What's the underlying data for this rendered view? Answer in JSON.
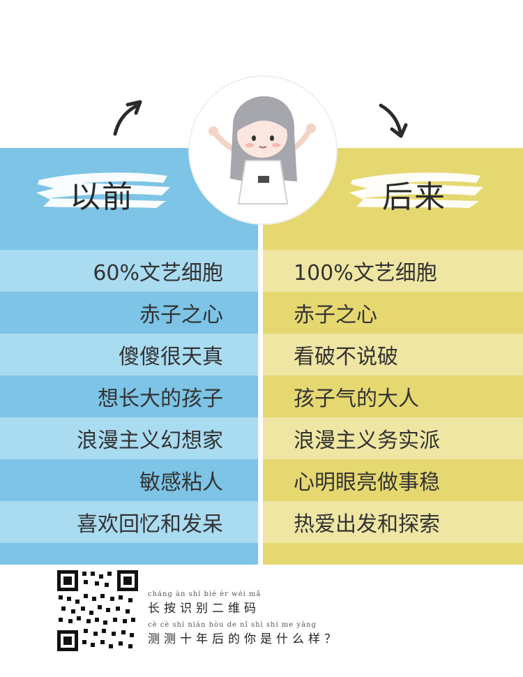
{
  "colors": {
    "left_panel": "#7dc4e6",
    "left_row_light": "#a9dbf1",
    "right_panel": "#e6d871",
    "right_row_light": "#efe6a3"
  },
  "icons": {
    "left_arrow": "curved-arrow-up-right-icon",
    "right_arrow": "curved-arrow-down-right-icon",
    "avatar": "cartoon-girl-shrugging-icon",
    "qr": "qr-code-icon"
  },
  "left": {
    "header": "以前",
    "items": [
      "60%文艺细胞",
      "赤子之心",
      "傻傻很天真",
      "想长大的孩子",
      "浪漫主义幻想家",
      "敏感粘人",
      "喜欢回忆和发呆"
    ]
  },
  "right": {
    "header": "后来",
    "items": [
      "100%文艺细胞",
      "赤子之心",
      "看破不说破",
      "孩子气的大人",
      "浪漫主义务实派",
      "心明眼亮做事稳",
      "热爱出发和探索"
    ]
  },
  "footer": {
    "line1_pinyin": "cháng àn shí bié èr wéi mǎ",
    "line1": "长按识别二维码",
    "line2_pinyin": "cè cè shí nián hòu de nǐ shì shí me yàng",
    "line2": "测测十年后的你是什么样？"
  }
}
